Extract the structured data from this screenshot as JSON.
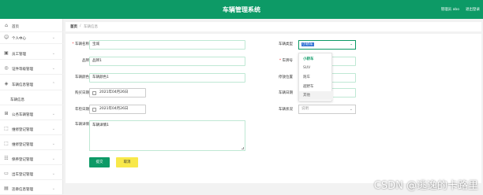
{
  "header": {
    "title": "车辆管理系统",
    "user": "管理员 abo",
    "logout": "退出登录"
  },
  "sidebar": {
    "items": [
      {
        "label": "首页",
        "icon": "home-icon",
        "glyph": "⌂"
      },
      {
        "label": "个人中心",
        "icon": "user-icon",
        "glyph": "☺"
      },
      {
        "label": "员工管理",
        "icon": "staff-icon",
        "glyph": "▣"
      },
      {
        "label": "证件等级管理",
        "icon": "certificate-icon",
        "glyph": "◎"
      },
      {
        "label": "车辆信息管理",
        "icon": "car-icon",
        "glyph": "◈"
      },
      {
        "label": "车辆信息",
        "icon": "",
        "glyph": ""
      },
      {
        "label": "公务车辆管理",
        "icon": "grid-icon",
        "glyph": "⊞"
      },
      {
        "label": "维修登记管理",
        "icon": "wrench-icon",
        "glyph": "⬚"
      },
      {
        "label": "维修登记管理",
        "icon": "frame-icon",
        "glyph": "⬚"
      },
      {
        "label": "保养登记管理",
        "icon": "list-icon",
        "glyph": "☷"
      },
      {
        "label": "出车登记管理",
        "icon": "monitor-icon",
        "glyph": "▭"
      },
      {
        "label": "违章信息管理",
        "icon": "info-icon",
        "glyph": "▤"
      }
    ]
  },
  "breadcrumb": {
    "home": "首页",
    "separator": "/",
    "current": "车辆信息"
  },
  "form": {
    "name_label": "车辆名称",
    "name_value": "宝城",
    "brand_label": "品牌",
    "brand_value": "品牌1",
    "color_label": "车辆颜色",
    "color_value": "车辆颜色1",
    "buy_date_label": "购买日期",
    "buy_date_value": "2021年04月26日",
    "annual_label": "年检日期",
    "annual_value": "2021年04月26日",
    "detail_label": "车辆详情",
    "detail_value": "车辆详情1",
    "type_label": "车辆类型",
    "type_value": "小轿车",
    "plate_label": "车牌号",
    "location_label": "停放位置",
    "record_label": "车辆日期",
    "status_label": "车辆状况",
    "status_placeholder": "说明",
    "type_options": [
      "小轿车",
      "SUV",
      "跑车",
      "越野车",
      "其他"
    ],
    "submit": "提交",
    "cancel": "取消"
  },
  "watermark": "CSDN @逃逸的卡路里",
  "colors": {
    "primary": "#0d9a66",
    "cancel": "#f8e84a",
    "background": "#f2f2f2"
  }
}
